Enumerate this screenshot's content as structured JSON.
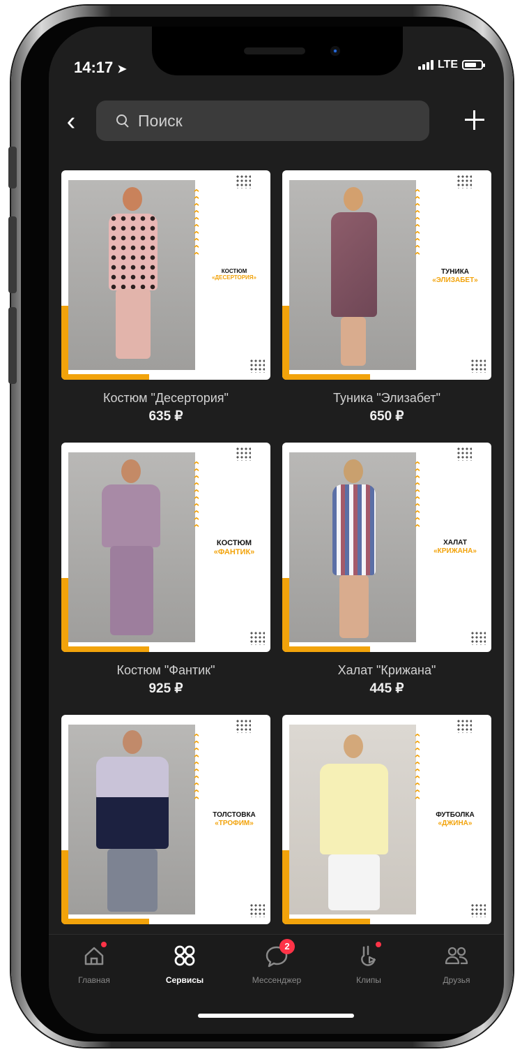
{
  "status": {
    "time": "14:17",
    "network": "LTE"
  },
  "search": {
    "placeholder": "Поиск"
  },
  "products": [
    {
      "name": "Костюм \"Десертория\"",
      "price": "635 ₽",
      "label_line1": "КОСТЮМ",
      "label_line2": "«ДЕСЕРТОРИЯ»"
    },
    {
      "name": "Туника \"Элизабет\"",
      "price": "650 ₽",
      "label_line1": "ТУНИКА",
      "label_line2": "«ЭЛИЗАБЕТ»"
    },
    {
      "name": "Костюм \"Фантик\"",
      "price": "925 ₽",
      "label_line1": "КОСТЮМ",
      "label_line2": "«ФАНТИК»"
    },
    {
      "name": "Халат \"Крижана\"",
      "price": "445 ₽",
      "label_line1": "ХАЛАТ",
      "label_line2": "«КРИЖАНА»"
    },
    {
      "name": "",
      "price": "",
      "label_line1": "ТОЛСТОВКА",
      "label_line2": "«ТРОФИМ»"
    },
    {
      "name": "",
      "price": "",
      "label_line1": "ФУТБОЛКА",
      "label_line2": "«ДЖИНА»"
    }
  ],
  "tabs": [
    {
      "label": "Главная",
      "icon": "home-icon",
      "badge": "dot"
    },
    {
      "label": "Сервисы",
      "icon": "services-icon",
      "active": true
    },
    {
      "label": "Мессенджер",
      "icon": "messenger-icon",
      "badge": "2"
    },
    {
      "label": "Клипы",
      "icon": "clips-icon",
      "badge": "dot"
    },
    {
      "label": "Друзья",
      "icon": "friends-icon"
    }
  ],
  "colors": {
    "accent": "#f2a30b",
    "badge": "#ff3347",
    "background": "#1e1e1e"
  }
}
